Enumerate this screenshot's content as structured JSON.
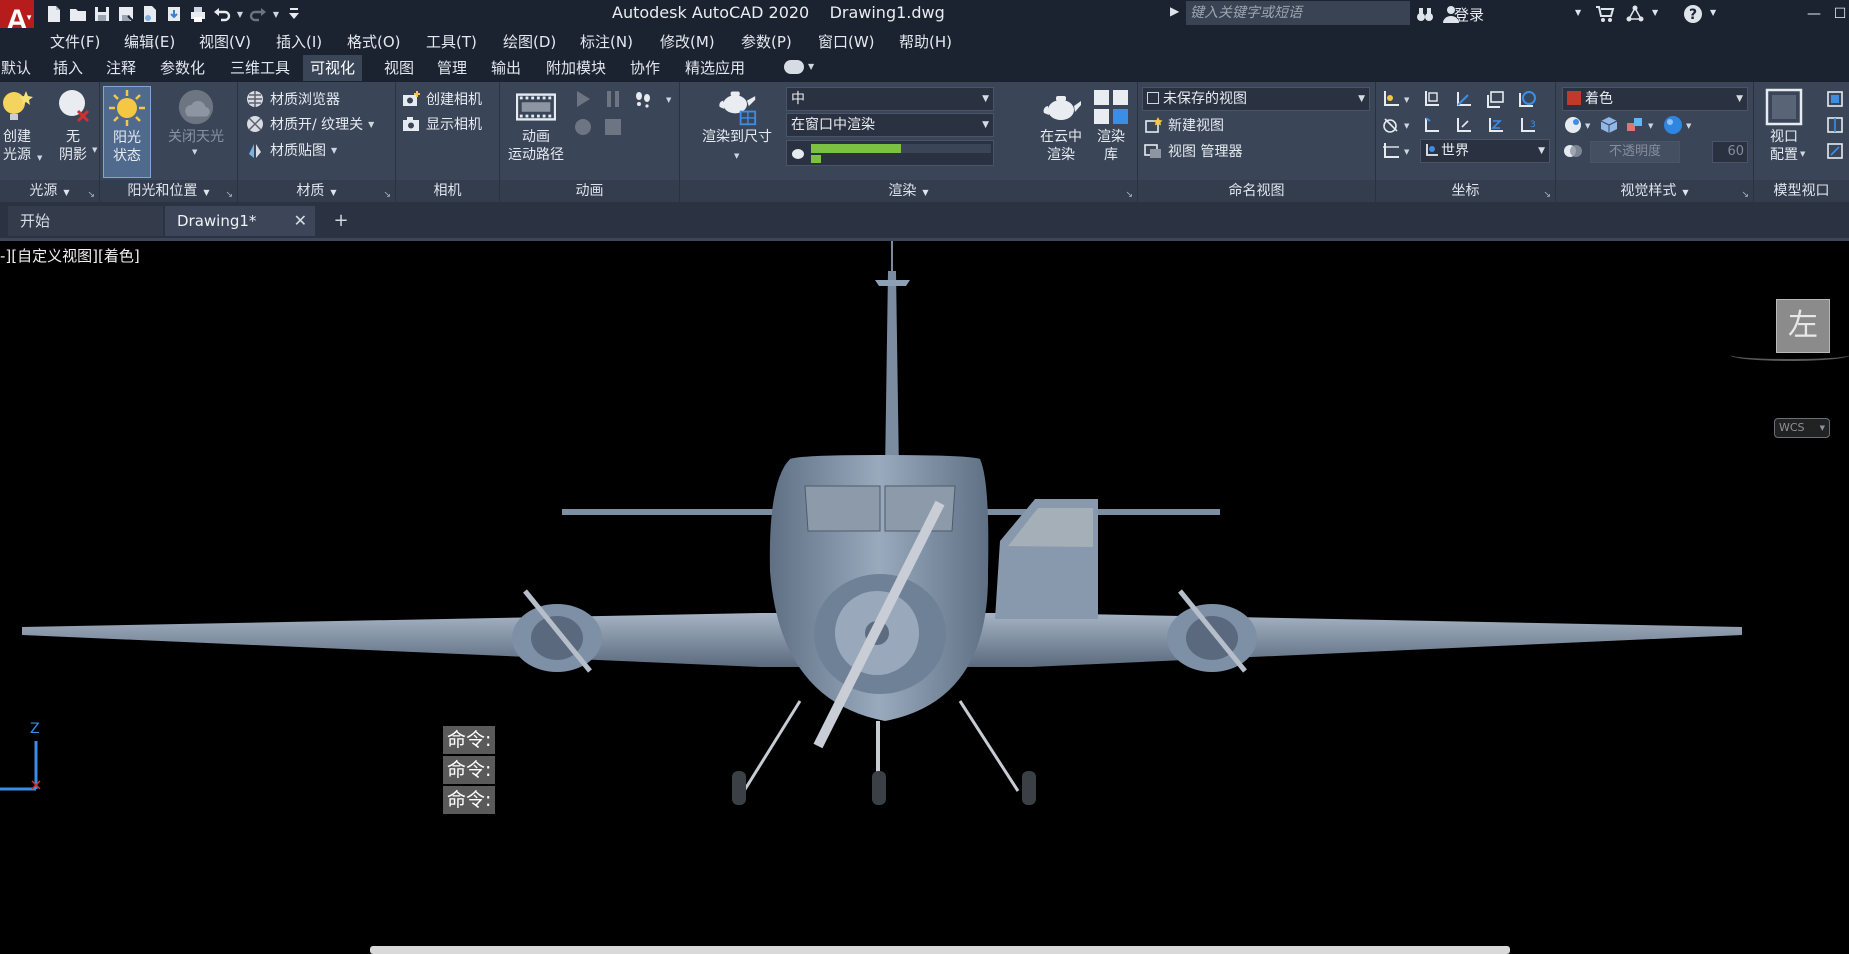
{
  "app": {
    "title": "Autodesk AutoCAD 2020    Drawing1.dwg",
    "logo_letter": "A",
    "search_placeholder": "键入关键字或短语",
    "login_label": "登录"
  },
  "menu": [
    "文件(F)",
    "编辑(E)",
    "视图(V)",
    "插入(I)",
    "格式(O)",
    "工具(T)",
    "绘图(D)",
    "标注(N)",
    "修改(M)",
    "参数(P)",
    "窗口(W)",
    "帮助(H)"
  ],
  "ribbon_tabs": [
    {
      "label": "默认"
    },
    {
      "label": "插入"
    },
    {
      "label": "注释"
    },
    {
      "label": "参数化"
    },
    {
      "label": "三维工具"
    },
    {
      "label": "可视化"
    },
    {
      "label": "视图"
    },
    {
      "label": "管理"
    },
    {
      "label": "输出"
    },
    {
      "label": "附加模块"
    },
    {
      "label": "协作"
    },
    {
      "label": "精选应用"
    }
  ],
  "panels": {
    "lights": {
      "title": "光源",
      "create_light": [
        "创建",
        "光源"
      ],
      "no_shadow": [
        "无",
        "阴影"
      ]
    },
    "sun": {
      "title": "阳光和位置",
      "sun_status": [
        "阳光",
        "状态"
      ],
      "sky_off": "关闭天光"
    },
    "materials": {
      "title": "材质",
      "browser": "材质浏览器",
      "toggle": "材质开/ 纹理关",
      "mapping": "材质贴图"
    },
    "camera": {
      "title": "相机",
      "create": "创建相机",
      "show": "显示相机"
    },
    "animation": {
      "title": "动画",
      "motion_path": [
        "动画",
        "运动路径"
      ]
    },
    "render": {
      "title": "渲染",
      "render_to_size": "渲染到尺寸",
      "quality": "中",
      "render_in": "在窗口中渲染",
      "cloud": [
        "在云中",
        "渲染"
      ],
      "library": [
        "渲染",
        "库"
      ],
      "progress_fraction": 0.5
    },
    "named_views": {
      "title": "命名视图",
      "unsaved": "未保存的视图",
      "new_view": "新建视图",
      "manager": "视图 管理器"
    },
    "coordinates": {
      "title": "坐标",
      "world": "世界"
    },
    "visual_styles": {
      "title": "视觉样式",
      "style": "着色",
      "opacity_label": "不透明度",
      "opacity_value": "60"
    },
    "model_viewports": {
      "title": "模型视口",
      "config": [
        "视口",
        "配置"
      ]
    }
  },
  "file_tabs": {
    "start": "开始",
    "active": "Drawing1*"
  },
  "viewport": {
    "label": "-][自定义视图][着色]",
    "viewcube_face": "左",
    "wcs": "WCS",
    "ucs_axis": "Z",
    "command_lines": [
      "命令:",
      "命令:",
      "命令:"
    ]
  },
  "colors": {
    "accent_red": "#b71c1c",
    "ribbon_bg": "#3b4558",
    "titlebar_bg": "#1b2230",
    "progress_green": "#7cc242"
  }
}
